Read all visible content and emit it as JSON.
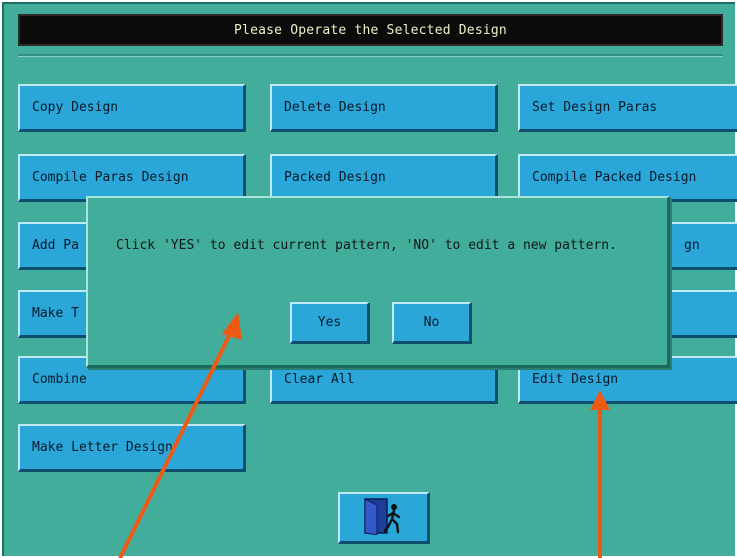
{
  "header": {
    "title": "Please Operate the Selected Design"
  },
  "buttons": {
    "copy_design": "Copy Design",
    "delete_design": "Delete Design",
    "set_design_paras": "Set Design Paras",
    "compile_paras_design": "Compile Paras Design",
    "packed_design": "Packed Design",
    "compile_packed_design": "Compile Packed Design",
    "add_partial": "Add Pa",
    "row3_right_partial": "gn",
    "make_partial": "Make T",
    "combine": "Combine",
    "clear_all": "Clear All",
    "edit_design": "Edit Design",
    "make_letter_design": "Make Letter Design"
  },
  "dialog": {
    "message": "Click 'YES' to edit current pattern, 'NO' to edit a new pattern.",
    "yes_label": "Yes",
    "no_label": "No"
  },
  "icons": {
    "exit": "exit-door-icon",
    "arrows": "pointer-arrow-icon"
  },
  "colors": {
    "background": "#43ad9b",
    "button": "#2aa6d9",
    "titlebar": "#0b0b0b",
    "title_text": "#f0f0c8",
    "arrow": "#ee5a14"
  }
}
